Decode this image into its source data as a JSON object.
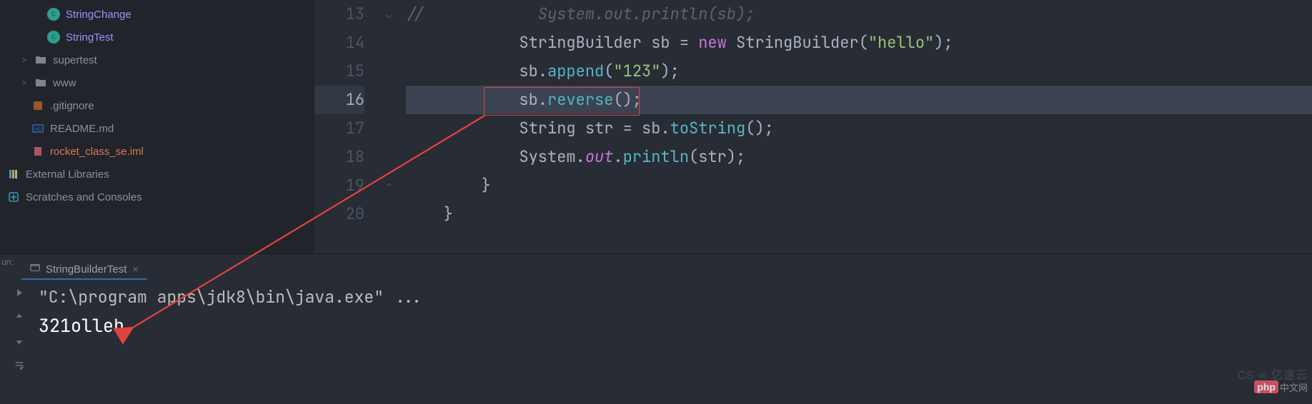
{
  "sidebar": {
    "items": [
      {
        "label": "StringChange",
        "icon": "java"
      },
      {
        "label": "StringTest",
        "icon": "java"
      },
      {
        "label": "supertest",
        "icon": "folder",
        "chevron": ">"
      },
      {
        "label": "www",
        "icon": "folder",
        "chevron": ">"
      },
      {
        "label": ".gitignore",
        "icon": "gitignore"
      },
      {
        "label": "README.md",
        "icon": "readme"
      },
      {
        "label": "rocket_class_se.iml",
        "icon": "iml"
      },
      {
        "label": "External Libraries",
        "icon": "ext"
      },
      {
        "label": "Scratches and Consoles",
        "icon": "scr"
      }
    ]
  },
  "editor": {
    "firstLine": 13,
    "highlightedLine": 16,
    "annotation_box_text": "sb.reverse();",
    "lines": {
      "l13": {
        "indent": "        ",
        "comment": "//            System.out.println(sb);"
      },
      "l14": {
        "indent": "            ",
        "type1": "StringBuilder",
        "var": "sb",
        "eq": " = ",
        "new": "new",
        "sp": " ",
        "type2": "StringBuilder",
        "paren1": "(",
        "str": "\"hello\"",
        "paren2": ")",
        "semi": ";"
      },
      "l15": {
        "indent": "            ",
        "obj": "sb",
        "dot": ".",
        "method": "append",
        "paren1": "(",
        "str": "\"123\"",
        "paren2": ")",
        "semi": ";"
      },
      "l16": {
        "indent": "            ",
        "obj": "sb",
        "dot": ".",
        "method": "reverse",
        "parens": "()",
        "semi": ";"
      },
      "l17": {
        "indent": "            ",
        "type": "String",
        "sp1": " ",
        "var": "str",
        "eq": " = ",
        "obj": "sb",
        "dot": ".",
        "method": "toString",
        "parens": "()",
        "semi": ";"
      },
      "l18": {
        "indent": "            ",
        "cls": "System",
        "dot1": ".",
        "field": "out",
        "dot2": ".",
        "method": "println",
        "paren1": "(",
        "arg": "str",
        "paren2": ")",
        "semi": ";"
      },
      "l19": {
        "indent": "        ",
        "brace": "}"
      },
      "l20": {
        "indent": "    ",
        "brace": "}"
      }
    },
    "gutter": [
      "13",
      "14",
      "15",
      "16",
      "17",
      "18",
      "19",
      "20"
    ]
  },
  "run_panel": {
    "side_label": "un:",
    "tab": {
      "label": "StringBuilderTest"
    },
    "console": {
      "line1": "\"C:\\program apps\\jdk8\\bin\\java.exe\" ...",
      "line2": "321olleh"
    }
  },
  "watermark": {
    "badge": "php",
    "text": "中文网",
    "sub": "CS ∞ 亿速云"
  }
}
